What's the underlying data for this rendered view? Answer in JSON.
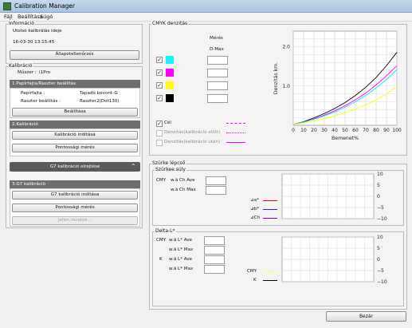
{
  "window": {
    "title": "Calibration Manager"
  },
  "menu": {
    "items": [
      "Fájl",
      "Beállítása",
      "Súgó"
    ]
  },
  "info": {
    "legend": "Információ",
    "last_cal_label": "Utolsó kalibrálás ideje",
    "last_cal_value": "16-03-30 13:15:45",
    "status_button": "Állapotellenőrzés"
  },
  "calibration": {
    "legend": "Kalibráció",
    "instrument_label": "Műszer :",
    "instrument_value": "i1Pro",
    "sec1_title": "1.Papírfajta/Raszter beállítás",
    "paper_label": "Papírfajta :",
    "paper_value": "Tapadó bevont-G",
    "raster_label": "Raszter beállítás :",
    "raster_value": "Raszter2(Dot130)",
    "settings_button": "Beállítása",
    "sec2_title": "2.Kalibráció",
    "start_button": "Kalibráció indítása",
    "accuracy_button": "Pontossági mérés",
    "g7_bar": "G7 kalibráció elrejtése",
    "sec3_title": "3.G7 kalibráció",
    "g7_start_button": "G7 kalibráció indítása",
    "g7_accuracy_button": "Pontossági mérés",
    "g7_disabled_button": "Jelen.rovatok..."
  },
  "cmyk": {
    "legend": "CMYK denzitás",
    "col_header_1": "Mérés",
    "col_header_2": "D-Max",
    "rows": [
      {
        "name": "C",
        "color": "#00ffff",
        "checked": true
      },
      {
        "name": "M",
        "color": "#ff00ff",
        "checked": true
      },
      {
        "name": "Y",
        "color": "#ffff00",
        "checked": true
      },
      {
        "name": "K",
        "color": "#000000",
        "checked": true
      }
    ],
    "legend_items": [
      {
        "label": "Cél",
        "checked": true,
        "enabled": true
      },
      {
        "label": "Denzitás(kalibráció előtt)",
        "checked": false,
        "enabled": false
      },
      {
        "label": "Denzitás(kalibráció után)",
        "checked": false,
        "enabled": false
      }
    ]
  },
  "chart_data": [
    {
      "type": "line",
      "title": "",
      "xlabel": "Bemenet%",
      "ylabel": "Denzitás km.",
      "x": [
        0,
        10,
        20,
        30,
        40,
        50,
        60,
        70,
        80,
        90,
        100
      ],
      "xlim": [
        0,
        100
      ],
      "ylim": [
        0,
        2.4
      ],
      "y_ticks": [
        1.0,
        2.0
      ],
      "x_ticks": [
        0,
        10,
        20,
        30,
        40,
        50,
        60,
        70,
        80,
        90,
        100
      ],
      "grid": true,
      "series": [
        {
          "color": "#000000",
          "values": [
            0.02,
            0.09,
            0.19,
            0.3,
            0.43,
            0.58,
            0.76,
            0.97,
            1.22,
            1.52,
            1.86
          ]
        },
        {
          "color": "#ff00ff",
          "values": [
            0.02,
            0.08,
            0.16,
            0.26,
            0.37,
            0.5,
            0.65,
            0.82,
            1.03,
            1.26,
            1.52
          ]
        },
        {
          "color": "#00e5ff",
          "values": [
            0.02,
            0.08,
            0.15,
            0.24,
            0.34,
            0.46,
            0.6,
            0.76,
            0.95,
            1.17,
            1.42
          ]
        },
        {
          "color": "#ffff00",
          "values": [
            0.02,
            0.06,
            0.11,
            0.17,
            0.24,
            0.32,
            0.41,
            0.52,
            0.65,
            0.8,
            0.98
          ]
        }
      ]
    },
    {
      "type": "line",
      "title": "",
      "ylim": [
        -10,
        10
      ],
      "y_ticks": [
        10,
        5,
        0,
        -5,
        -10
      ],
      "grid": true,
      "series": []
    },
    {
      "type": "line",
      "title": "",
      "ylim": [
        -10,
        10
      ],
      "y_ticks": [
        10,
        5,
        0,
        -5,
        -10
      ],
      "grid": true,
      "series": []
    }
  ],
  "grey": {
    "legend": "Szürke lépcső",
    "balance_legend": "Szürkee.súly",
    "cmy_label": "CMY",
    "ch_ave_label": "w.ä Ch Ave",
    "ch_max_label": "w.ä Ch Max",
    "legend_a": "⊿a*",
    "legend_b": "⊿b*",
    "legend_ch": "⊿Ch",
    "color_a": "#ff0000",
    "color_b": "#2020ff",
    "color_ch": "#8000a0"
  },
  "delta": {
    "legend": "Delta-L*",
    "cmy_label": "CMY",
    "k_label": "K",
    "l_ave_label": "w.ä L* Ave",
    "l_max_label": "w.ä L* Max",
    "legend_cmy": "CMY",
    "legend_k": "K",
    "color_cmy": "#ffff66",
    "color_k": "#000000"
  },
  "footer": {
    "close_button": "Bezár"
  }
}
